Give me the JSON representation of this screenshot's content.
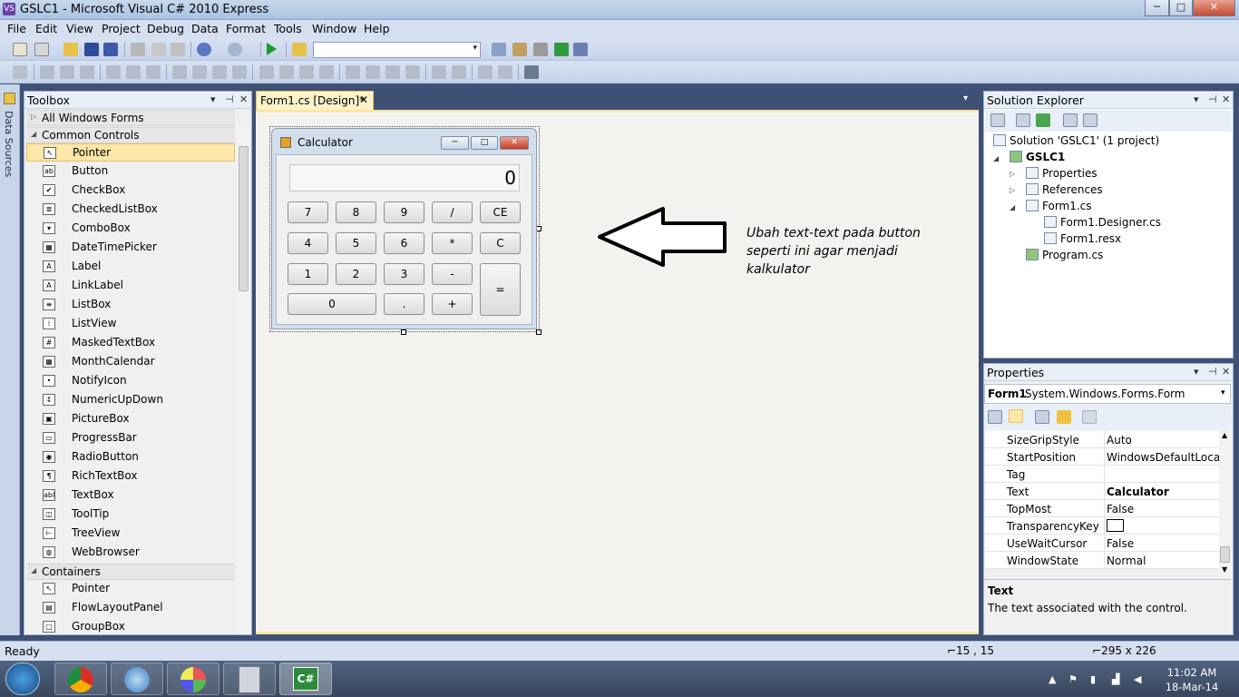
{
  "window": {
    "title": "GSLC1 - Microsoft Visual C# 2010 Express",
    "app_icon": "VS",
    "min": "─",
    "max": "□",
    "close": "✕"
  },
  "menu": [
    "File",
    "Edit",
    "View",
    "Project",
    "Debug",
    "Data",
    "Format",
    "Tools",
    "Window",
    "Help"
  ],
  "target_combo": {
    "value": "",
    "arrow": "▾"
  },
  "datasources_strip": {
    "label": "Data Sources"
  },
  "toolbox": {
    "title": "Toolbox",
    "controls": [
      "▾",
      "⊣",
      "✕"
    ],
    "groups": [
      {
        "label": "All Windows Forms",
        "arrow": "▷"
      },
      {
        "label": "Common Controls",
        "arrow": "◢"
      },
      {
        "label": "Containers",
        "arrow": "◢"
      }
    ],
    "common_items": [
      {
        "icon": "↖",
        "label": "Pointer"
      },
      {
        "icon": "ab",
        "label": "Button"
      },
      {
        "icon": "✔",
        "label": "CheckBox"
      },
      {
        "icon": "≣",
        "label": "CheckedListBox"
      },
      {
        "icon": "▾",
        "label": "ComboBox"
      },
      {
        "icon": "▦",
        "label": "DateTimePicker"
      },
      {
        "icon": "A",
        "label": "Label"
      },
      {
        "icon": "A",
        "label": "LinkLabel"
      },
      {
        "icon": "≡",
        "label": "ListBox"
      },
      {
        "icon": "⁞",
        "label": "ListView"
      },
      {
        "icon": "#",
        "label": "MaskedTextBox"
      },
      {
        "icon": "▦",
        "label": "MonthCalendar"
      },
      {
        "icon": "•",
        "label": "NotifyIcon"
      },
      {
        "icon": "↕",
        "label": "NumericUpDown"
      },
      {
        "icon": "▣",
        "label": "PictureBox"
      },
      {
        "icon": "▭",
        "label": "ProgressBar"
      },
      {
        "icon": "◉",
        "label": "RadioButton"
      },
      {
        "icon": "¶",
        "label": "RichTextBox"
      },
      {
        "icon": "abl",
        "label": "TextBox"
      },
      {
        "icon": "◫",
        "label": "ToolTip"
      },
      {
        "icon": "⊢",
        "label": "TreeView"
      },
      {
        "icon": "◍",
        "label": "WebBrowser"
      }
    ],
    "container_items": [
      {
        "icon": "↖",
        "label": "Pointer"
      },
      {
        "icon": "▤",
        "label": "FlowLayoutPanel"
      },
      {
        "icon": "▢",
        "label": "GroupBox"
      }
    ]
  },
  "doc_tab": {
    "label": "Form1.cs [Design]*",
    "close": "✕",
    "dropdown": "▾"
  },
  "calc": {
    "title": "Calculator",
    "display": "0",
    "min": "─",
    "max": "□",
    "close": "✕",
    "buttons": {
      "b7": "7",
      "b8": "8",
      "b9": "9",
      "bdiv": "/",
      "bce": "CE",
      "b4": "4",
      "b5": "5",
      "b6": "6",
      "bmul": "*",
      "bc": "C",
      "b1": "1",
      "b2": "2",
      "b3": "3",
      "bsub": "-",
      "beq": "=",
      "b0": "0",
      "bdot": ".",
      "badd": "+"
    }
  },
  "annotation": {
    "text": "Ubah text-text pada button seperti ini agar menjadi kalkulator"
  },
  "solution_explorer": {
    "title": "Solution Explorer",
    "controls": [
      "▾",
      "⊣",
      "✕"
    ],
    "nodes": {
      "solution": "Solution 'GSLC1' (1 project)",
      "project": "GSLC1",
      "properties": "Properties",
      "references": "References",
      "form1": "Form1.cs",
      "designer": "Form1.Designer.cs",
      "resx": "Form1.resx",
      "program": "Program.cs"
    },
    "expanders": {
      "project": "◢",
      "properties": "▷",
      "references": "▷",
      "form1": "◢"
    }
  },
  "properties": {
    "title": "Properties",
    "controls": [
      "▾",
      "⊣",
      "✕"
    ],
    "object_name": "Form1",
    "object_type": "System.Windows.Forms.Form",
    "object_arrow": "▾",
    "rows": [
      {
        "name": "SizeGripStyle",
        "value": "Auto"
      },
      {
        "name": "StartPosition",
        "value": "WindowsDefaultLocation"
      },
      {
        "name": "Tag",
        "value": ""
      },
      {
        "name": "Text",
        "value": "Calculator"
      },
      {
        "name": "TopMost",
        "value": "False"
      },
      {
        "name": "TransparencyKey",
        "value": ""
      },
      {
        "name": "UseWaitCursor",
        "value": "False"
      },
      {
        "name": "WindowState",
        "value": "Normal"
      }
    ],
    "desc_title": "Text",
    "desc_text": "The text associated with the control.",
    "scroll_up": "▲",
    "scroll_down": "▼"
  },
  "status": {
    "text": "Ready",
    "position": "15 , 15",
    "size": "295 x 226"
  },
  "taskbar": {
    "time": "11:02 AM",
    "date": "18-Mar-14",
    "start_icon": "start-orb",
    "apps": [
      "chrome",
      "itunes",
      "paint",
      "calculator",
      "visual-csharp"
    ],
    "active_app_label": "C#"
  },
  "colors": {
    "selection": "#fce6a8",
    "titlebar": "#b7cce6",
    "taskbar": "#44536d"
  }
}
